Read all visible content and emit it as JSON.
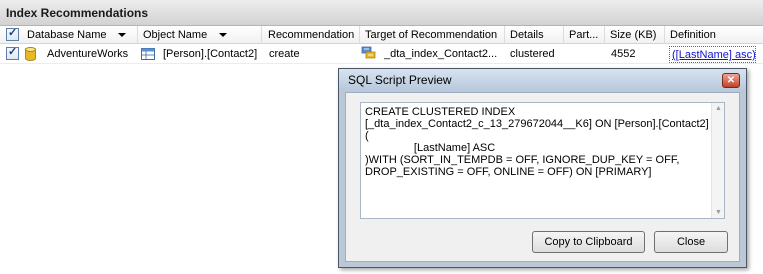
{
  "panel": {
    "title": "Index Recommendations"
  },
  "columns": [
    "Database Name",
    "Object Name",
    "Recommendation",
    "Target of Recommendation",
    "Details",
    "Part...",
    "Size (KB)",
    "Definition"
  ],
  "row": {
    "checked": true,
    "database_name": "AdventureWorks",
    "object_name": "[Person].[Contact2]",
    "recommendation": "create",
    "target": "_dta_index_Contact2...",
    "details": "clustered",
    "partition": "",
    "size_kb": "4552",
    "definition": "([LastName] asc)"
  },
  "dialog": {
    "title": "SQL Script Preview",
    "script": "CREATE CLUSTERED INDEX\n[_dta_index_Contact2_c_13_279672044__K6] ON [Person].[Contact2]\n(\n                [LastName] ASC\n)WITH (SORT_IN_TEMPDB = OFF, IGNORE_DUP_KEY = OFF,\nDROP_EXISTING = OFF, ONLINE = OFF) ON [PRIMARY]",
    "copy_button": "Copy to Clipboard",
    "close_button": "Close"
  },
  "colors": {
    "link": "#1111cc",
    "close_button": "#c2412a",
    "dialog_frame": "#bcc8d6"
  }
}
